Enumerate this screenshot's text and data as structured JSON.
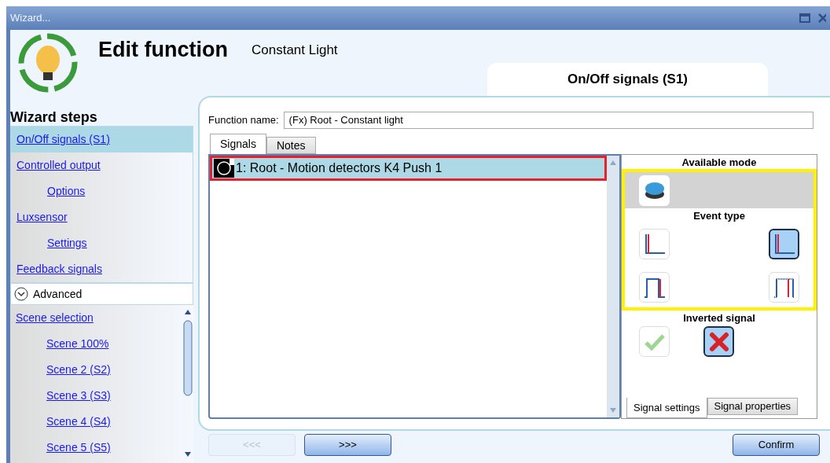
{
  "window": {
    "title": "Wizard..."
  },
  "header": {
    "title": "Edit function",
    "subtitle": "Constant Light",
    "step_tab": "On/Off signals (S1)"
  },
  "sidebar": {
    "heading": "Wizard steps",
    "steps": [
      {
        "label": "On/Off signals (S1)",
        "selected": true
      },
      {
        "label": "Controlled output",
        "selected": false,
        "children": [
          {
            "label": "Options",
            "selected": false
          }
        ]
      },
      {
        "label": "Luxsensor",
        "selected": false,
        "children": [
          {
            "label": "Settings",
            "selected": false
          }
        ]
      },
      {
        "label": "Feedback signals",
        "selected": false
      }
    ],
    "advanced": {
      "label": "Advanced",
      "expanded": true,
      "steps": [
        {
          "label": "Scene selection",
          "selected": false,
          "children": [
            {
              "label": "Scene 100%",
              "selected": false
            },
            {
              "label": "Scene 2 (S2)",
              "selected": false
            },
            {
              "label": "Scene 3 (S3)",
              "selected": false
            },
            {
              "label": "Scene 4 (S4)",
              "selected": false
            },
            {
              "label": "Scene 5 (S5)",
              "selected": false
            }
          ]
        }
      ]
    }
  },
  "function_name": {
    "label": "Function name:",
    "value": "(Fx) Root - Constant light"
  },
  "tabs": [
    {
      "label": "Signals",
      "selected": true
    },
    {
      "label": "Notes",
      "selected": false
    }
  ],
  "signals": [
    {
      "label": "1: Root - Motion detectors K4 Push 1",
      "selected": true
    }
  ],
  "signal_settings": {
    "available_mode": {
      "heading": "Available mode",
      "modes": [
        {
          "kind": "push-button",
          "selected": true
        }
      ]
    },
    "event_type": {
      "heading": "Event type",
      "options": [
        {
          "kind": "rise-left",
          "selected": false
        },
        {
          "kind": "rise-left-filled",
          "selected": true
        },
        {
          "kind": "pulse-fall",
          "selected": false
        },
        {
          "kind": "pulse-dotted",
          "selected": false
        }
      ]
    },
    "inverted_signal": {
      "heading": "Inverted signal",
      "inverted": false
    },
    "tabs": [
      {
        "label": "Signal settings",
        "selected": true
      },
      {
        "label": "Signal properties",
        "selected": false
      }
    ]
  },
  "buttons": [
    {
      "label": "<<<",
      "disabled": true
    },
    {
      "label": ">>>",
      "disabled": false
    },
    {
      "label": "Confirm",
      "disabled": false
    }
  ]
}
